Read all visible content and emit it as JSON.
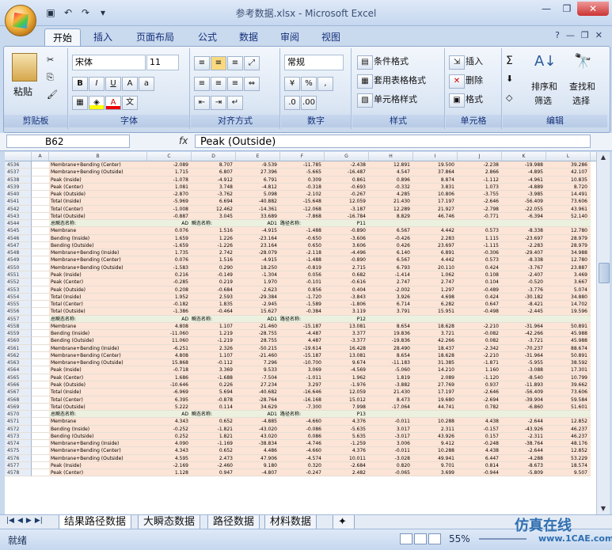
{
  "title": "参考数据.xlsx - Microsoft Excel",
  "tabs": [
    "开始",
    "插入",
    "页面布局",
    "公式",
    "数据",
    "审阅",
    "视图"
  ],
  "ribbon": {
    "clipboard": {
      "paste": "粘贴",
      "label": "剪贴板"
    },
    "font": {
      "name": "宋体",
      "size": "11",
      "label": "字体"
    },
    "align": {
      "label": "对齐方式"
    },
    "number": {
      "format": "常规",
      "pct": "%",
      "comma": ",",
      "label": "数字"
    },
    "styles": {
      "cond": "条件格式",
      "table": "套用表格格式",
      "cell": "单元格样式",
      "label": "样式"
    },
    "cells": {
      "insert": "插入",
      "delete": "删除",
      "format": "格式",
      "label": "单元格"
    },
    "edit": {
      "sort": "排序和",
      "sort2": "筛选",
      "find": "查找和",
      "find2": "选择",
      "label": "编辑"
    }
  },
  "formula": {
    "cell": "B62",
    "value": "Peak (Outside)"
  },
  "columns": [
    "A",
    "B",
    "C",
    "D",
    "E",
    "F",
    "G",
    "H",
    "I",
    "J",
    "K",
    "L"
  ],
  "rows": [
    {
      "n": "4536",
      "b": "Membrane+Bending (Center)",
      "v": [
        "-2.089",
        "8.707",
        "-9.539",
        "-11.785",
        "-2.438",
        "12.891",
        "19.500",
        "-2.238",
        "-19.988",
        "39.286"
      ]
    },
    {
      "n": "4537",
      "b": "Membrane+Bending (Outside)",
      "v": [
        "1.715",
        "6.807",
        "27.396",
        "-5.665",
        "-16.487",
        "4.547",
        "37.864",
        "2.866",
        "-4.895",
        "42.107"
      ]
    },
    {
      "n": "4538",
      "b": "Peak (Inside)",
      "v": [
        "-1.078",
        "-4.912",
        "6.791",
        "0.309",
        "0.861",
        "0.896",
        "8.874",
        "-1.112",
        "-4.961",
        "10.835"
      ]
    },
    {
      "n": "4539",
      "b": "Peak (Center)",
      "v": [
        "1.081",
        "3.748",
        "-4.812",
        "-0.318",
        "-0.693",
        "-0.332",
        "3.831",
        "1.073",
        "-4.889",
        "8.720"
      ]
    },
    {
      "n": "4540",
      "b": "Peak (Outside)",
      "v": [
        "-2.870",
        "-3.762",
        "5.098",
        "-2.102",
        "-0.267",
        "4.285",
        "10.806",
        "-3.755",
        "-3.985",
        "14.491"
      ]
    },
    {
      "n": "4541",
      "b": "Total (Inside)",
      "v": [
        "-5.969",
        "6.694",
        "-40.882",
        "-15.648",
        "12.059",
        "21.430",
        "17.197",
        "-2.646",
        "-56.409",
        "73.606"
      ]
    },
    {
      "n": "4542",
      "b": "Total (Center)",
      "v": [
        "-1.008",
        "12.462",
        "-14.361",
        "-12.068",
        "-3.187",
        "12.289",
        "21.927",
        "-2.798",
        "-22.055",
        "43.961"
      ]
    },
    {
      "n": "4543",
      "b": "Total (Outside)",
      "v": [
        "-0.887",
        "3.045",
        "33.689",
        "-7.868",
        "-16.784",
        "8.829",
        "46.746",
        "-0.771",
        "-6.394",
        "52.140"
      ]
    },
    {
      "n": "4544",
      "sect": true,
      "b": "总瞬态名称:",
      "c": "AD",
      "d": "瞬态名称:",
      "e": "AD1",
      "f": "路径名称:",
      "g": "P11"
    },
    {
      "n": "4545",
      "b": "Membrane",
      "v": [
        "0.076",
        "1.516",
        "-4.915",
        "-1.488",
        "-0.890",
        "6.567",
        "4.442",
        "0.573",
        "-8.338",
        "12.780"
      ]
    },
    {
      "n": "4546",
      "b": "Bending (Inside)",
      "v": [
        "1.659",
        "1.226",
        "-23.164",
        "-0.650",
        "-3.606",
        "-0.426",
        "2.283",
        "1.115",
        "-23.697",
        "28.979"
      ]
    },
    {
      "n": "4547",
      "b": "Bending (Outside)",
      "v": [
        "-1.659",
        "-1.226",
        "23.164",
        "0.650",
        "3.606",
        "0.426",
        "23.697",
        "-1.115",
        "-2.283",
        "28.979"
      ]
    },
    {
      "n": "4548",
      "b": "Membrane+Bending (Inside)",
      "v": [
        "1.735",
        "2.742",
        "-28.079",
        "-2.118",
        "-4.496",
        "6.140",
        "6.891",
        "-0.306",
        "-29.407",
        "34.988"
      ]
    },
    {
      "n": "4549",
      "b": "Membrane+Bending (Center)",
      "v": [
        "0.076",
        "1.516",
        "-4.915",
        "-1.488",
        "-0.890",
        "6.567",
        "4.442",
        "0.573",
        "-8.338",
        "12.780"
      ]
    },
    {
      "n": "4550",
      "b": "Membrane+Bending (Outside)",
      "v": [
        "-1.583",
        "0.290",
        "18.250",
        "-0.819",
        "2.715",
        "6.793",
        "20.110",
        "0.424",
        "-3.767",
        "23.887"
      ]
    },
    {
      "n": "4551",
      "b": "Peak (Inside)",
      "v": [
        "0.216",
        "-0.149",
        "-1.304",
        "0.056",
        "0.682",
        "-1.414",
        "1.062",
        "0.108",
        "-2.407",
        "3.469"
      ]
    },
    {
      "n": "4552",
      "b": "Peak (Center)",
      "v": [
        "-0.285",
        "0.219",
        "1.970",
        "-0.101",
        "-0.616",
        "2.747",
        "2.747",
        "0.104",
        "-0.520",
        "3.667"
      ]
    },
    {
      "n": "4553",
      "b": "Peak (Outside)",
      "v": [
        "0.208",
        "-0.684",
        "-2.623",
        "0.856",
        "0.404",
        "-2.002",
        "1.297",
        "-0.489",
        "-3.776",
        "5.074"
      ]
    },
    {
      "n": "4554",
      "b": "Total (Inside)",
      "v": [
        "1.952",
        "2.593",
        "-29.384",
        "-1.720",
        "-3.843",
        "3.926",
        "4.698",
        "0.424",
        "-30.182",
        "34.880"
      ]
    },
    {
      "n": "4555",
      "b": "Total (Center)",
      "v": [
        "-0.182",
        "1.835",
        "-2.945",
        "-1.589",
        "-1.806",
        "6.714",
        "6.282",
        "0.647",
        "-8.421",
        "14.702"
      ]
    },
    {
      "n": "4556",
      "b": "Total (Outside)",
      "v": [
        "-1.386",
        "-0.464",
        "15.627",
        "-0.384",
        "3.119",
        "3.791",
        "15.951",
        "-0.498",
        "-2.445",
        "19.596"
      ]
    },
    {
      "n": "4557",
      "sect": true,
      "b": "总瞬态名称:",
      "c": "AD",
      "d": "瞬态名称:",
      "e": "AD1",
      "f": "路径名称:",
      "g": "P12"
    },
    {
      "n": "4558",
      "b": "Membrane",
      "v": [
        "4.808",
        "1.107",
        "-21.460",
        "-15.187",
        "13.081",
        "8.654",
        "18.628",
        "-2.210",
        "-31.964",
        "50.891"
      ]
    },
    {
      "n": "4559",
      "b": "Bending (Inside)",
      "v": [
        "-11.060",
        "1.219",
        "-28.755",
        "-4.487",
        "3.377",
        "19.836",
        "3.721",
        "-0.082",
        "-42.266",
        "45.988"
      ]
    },
    {
      "n": "4560",
      "b": "Bending (Outside)",
      "v": [
        "11.060",
        "-1.219",
        "28.755",
        "4.487",
        "-3.377",
        "-19.836",
        "42.266",
        "0.082",
        "-3.721",
        "45.988"
      ]
    },
    {
      "n": "4561",
      "b": "Membrane+Bending (Inside)",
      "v": [
        "-6.251",
        "2.326",
        "-50.215",
        "-19.614",
        "16.428",
        "28.490",
        "18.437",
        "-2.342",
        "-70.237",
        "88.674"
      ]
    },
    {
      "n": "4562",
      "b": "Membrane+Bending (Center)",
      "v": [
        "4.808",
        "1.107",
        "-21.460",
        "-15.187",
        "13.081",
        "8.654",
        "18.628",
        "-2.210",
        "-31.964",
        "50.891"
      ]
    },
    {
      "n": "4563",
      "b": "Membrane+Bending (Outside)",
      "v": [
        "15.868",
        "-0.112",
        "7.296",
        "-10.700",
        "9.674",
        "-11.183",
        "31.385",
        "-1.871",
        "-5.955",
        "38.592"
      ]
    },
    {
      "n": "4564",
      "b": "Peak (Inside)",
      "v": [
        "-0.718",
        "3.369",
        "9.533",
        "3.069",
        "-4.569",
        "-5.060",
        "14.210",
        "1.160",
        "-3.088",
        "17.301"
      ]
    },
    {
      "n": "4565",
      "b": "Peak (Center)",
      "v": [
        "1.686",
        "-1.688",
        "-7.504",
        "-1.011",
        "1.962",
        "1.819",
        "2.089",
        "-1.120",
        "-8.540",
        "10.799"
      ]
    },
    {
      "n": "4566",
      "b": "Peak (Outside)",
      "v": [
        "-10.646",
        "0.226",
        "27.234",
        "3.297",
        "-1.976",
        "-3.882",
        "27.769",
        "0.937",
        "-11.893",
        "39.662"
      ]
    },
    {
      "n": "4567",
      "b": "Total (Inside)",
      "v": [
        "-6.969",
        "5.694",
        "-40.682",
        "-16.646",
        "12.059",
        "21.430",
        "17.197",
        "-2.646",
        "-56.409",
        "73.606"
      ]
    },
    {
      "n": "4568",
      "b": "Total (Center)",
      "v": [
        "6.395",
        "-0.878",
        "-28.764",
        "-16.168",
        "15.012",
        "8.473",
        "19.680",
        "-2.694",
        "-39.904",
        "59.584"
      ]
    },
    {
      "n": "4569",
      "b": "Total (Outside)",
      "v": [
        "5.222",
        "0.114",
        "34.629",
        "-7.300",
        "7.998",
        "-17.064",
        "44.741",
        "0.782",
        "-6.860",
        "51.601"
      ]
    },
    {
      "n": "4570",
      "sect": true,
      "b": "总瞬态名称:",
      "c": "AD",
      "d": "瞬态名称:",
      "e": "AD1",
      "f": "路径名称:",
      "g": "P13"
    },
    {
      "n": "4571",
      "b": "Membrane",
      "v": [
        "4.343",
        "0.652",
        "-4.885",
        "-4.660",
        "4.376",
        "-0.011",
        "10.288",
        "4.438",
        "-2.644",
        "12.852"
      ]
    },
    {
      "n": "4572",
      "b": "Bending (Inside)",
      "v": [
        "-0.252",
        "-1.821",
        "-43.020",
        "-0.086",
        "-5.635",
        "3.017",
        "2.311",
        "-0.157",
        "-43.926",
        "46.237"
      ]
    },
    {
      "n": "4573",
      "b": "Bending (Outside)",
      "v": [
        "0.252",
        "1.821",
        "43.020",
        "0.086",
        "5.635",
        "-3.017",
        "43.926",
        "0.157",
        "-2.311",
        "46.237"
      ]
    },
    {
      "n": "4574",
      "b": "Membrane+Bending (Inside)",
      "v": [
        "4.090",
        "-1.169",
        "-38.834",
        "-4.746",
        "-1.259",
        "3.006",
        "9.412",
        "-0.248",
        "-38.764",
        "48.176"
      ]
    },
    {
      "n": "4575",
      "b": "Membrane+Bending (Center)",
      "v": [
        "4.343",
        "0.652",
        "4.486",
        "-4.660",
        "4.376",
        "-0.011",
        "10.288",
        "4.438",
        "-2.644",
        "12.852"
      ]
    },
    {
      "n": "4576",
      "b": "Membrane+Bending (Outside)",
      "v": [
        "4.595",
        "2.473",
        "47.906",
        "-4.574",
        "10.011",
        "-3.028",
        "49.941",
        "6.447",
        "-4.288",
        "53.229"
      ]
    },
    {
      "n": "4577",
      "b": "Peak (Inside)",
      "v": [
        "-2.169",
        "-2.460",
        "9.180",
        "0.320",
        "-2.684",
        "0.820",
        "9.701",
        "0.814",
        "-8.673",
        "18.574"
      ]
    },
    {
      "n": "4578",
      "b": "Peak (Center)",
      "v": [
        "1.128",
        "0.947",
        "-4.807",
        "-0.247",
        "2.482",
        "-0.065",
        "3.699",
        "-0.944",
        "-5.809",
        "9.507"
      ]
    }
  ],
  "sheets": [
    "结果路径数据",
    "大瞬态数据",
    "路径数据",
    "材料数据"
  ],
  "status": {
    "ready": "就绪",
    "zoom": "55%"
  },
  "watermark": {
    "line1": "仿真在线",
    "line2": "www.1CAE.com"
  }
}
